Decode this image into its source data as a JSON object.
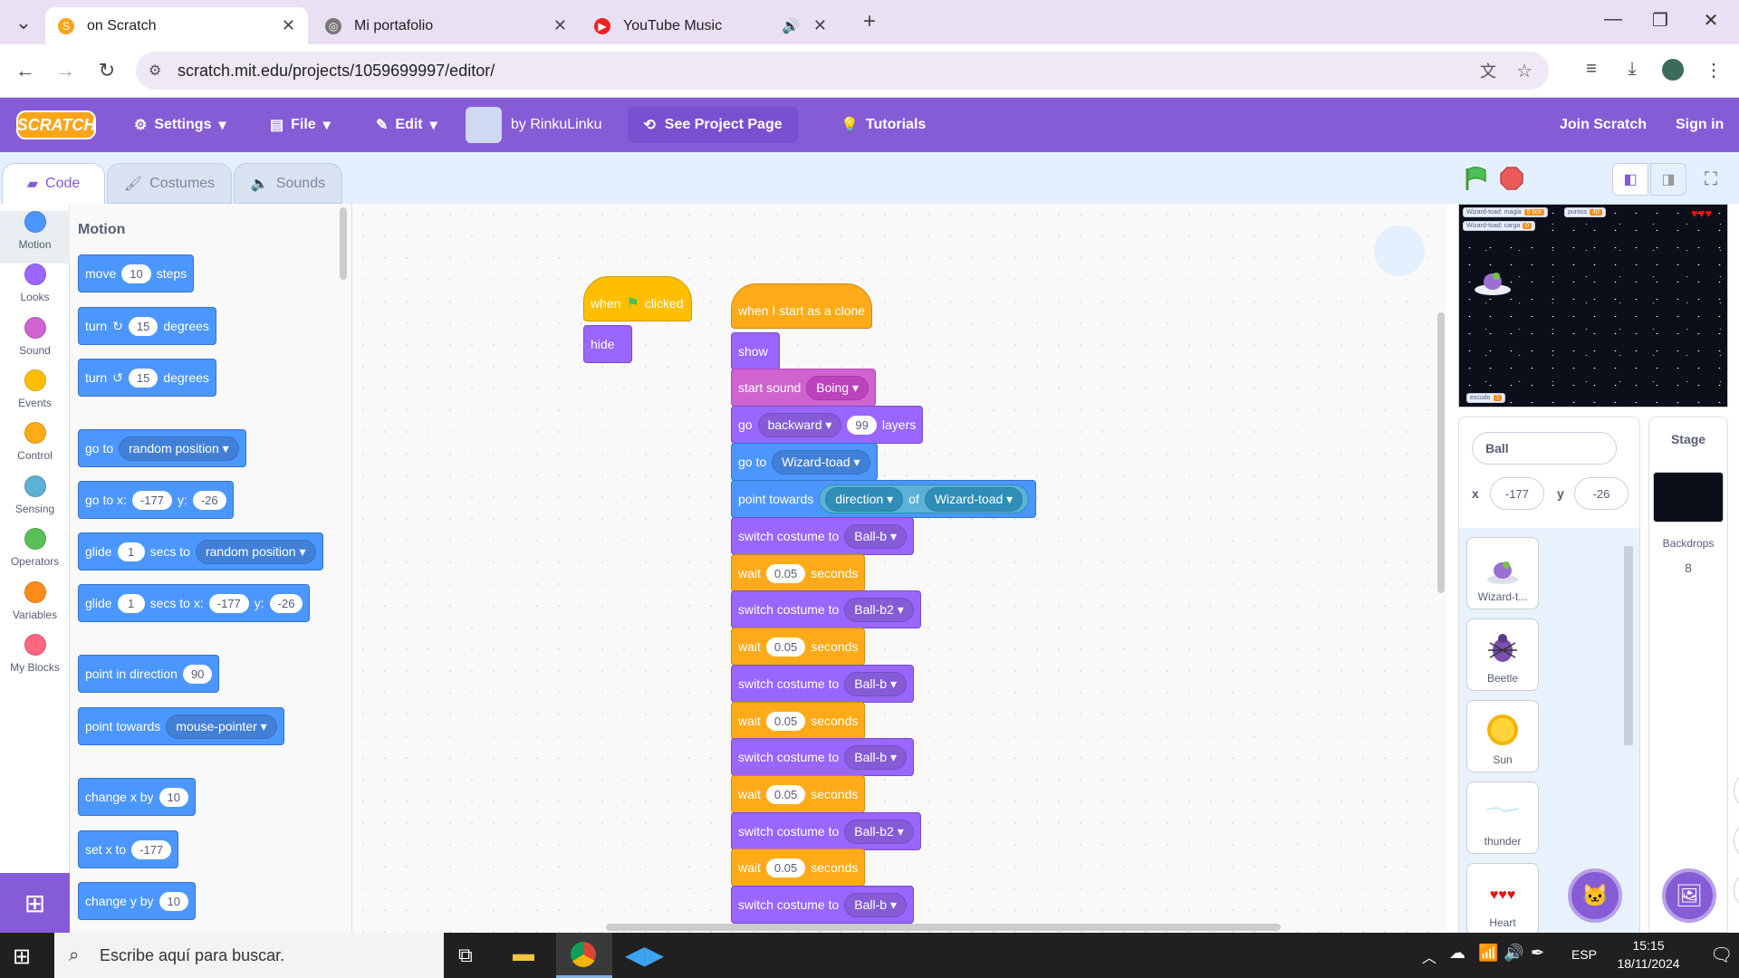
{
  "browser": {
    "tabs": [
      {
        "title": "on Scratch",
        "active": true
      },
      {
        "title": "Mi portafolio",
        "active": false
      },
      {
        "title": "YouTube Music",
        "active": false
      }
    ],
    "url": "scratch.mit.edu/projects/1059699997/editor/"
  },
  "menubar": {
    "logo": "SCRATCH",
    "settings": "Settings",
    "file": "File",
    "edit": "Edit",
    "author": "by RinkuLinku",
    "see_project": "See Project Page",
    "tutorials": "Tutorials",
    "join": "Join Scratch",
    "sign_in": "Sign in"
  },
  "editor_tabs": {
    "code": "Code",
    "costumes": "Costumes",
    "sounds": "Sounds"
  },
  "categories": [
    {
      "label": "Motion",
      "color": "#4c97ff"
    },
    {
      "label": "Looks",
      "color": "#9966ff"
    },
    {
      "label": "Sound",
      "color": "#cf63cf"
    },
    {
      "label": "Events",
      "color": "#ffbf00"
    },
    {
      "label": "Control",
      "color": "#ffab19"
    },
    {
      "label": "Sensing",
      "color": "#5cb1d6"
    },
    {
      "label": "Operators",
      "color": "#59c059"
    },
    {
      "label": "Variables",
      "color": "#ff8c1a"
    },
    {
      "label": "My Blocks",
      "color": "#ff6680"
    }
  ],
  "palette": {
    "title": "Motion",
    "move": {
      "t1": "move",
      "v": "10",
      "t2": "steps"
    },
    "turn_right": {
      "t1": "turn",
      "v": "15",
      "t2": "degrees"
    },
    "turn_left": {
      "t1": "turn",
      "v": "15",
      "t2": "degrees"
    },
    "goto": {
      "t1": "go to",
      "dd": "random position"
    },
    "gotoxy": {
      "t1": "go to x:",
      "x": "-177",
      "t2": "y:",
      "y": "-26"
    },
    "glide_to": {
      "t1": "glide",
      "v": "1",
      "t2": "secs to",
      "dd": "random position"
    },
    "glide_xy": {
      "t1": "glide",
      "v": "1",
      "t2": "secs to x:",
      "x": "-177",
      "t3": "y:",
      "y": "-26"
    },
    "point_dir": {
      "t1": "point in direction",
      "v": "90"
    },
    "point_towards": {
      "t1": "point towards",
      "dd": "mouse-pointer"
    },
    "change_x": {
      "t1": "change x by",
      "v": "10"
    },
    "set_x": {
      "t1": "set x to",
      "v": "-177"
    },
    "change_y": {
      "t1": "change y by",
      "v": "10"
    }
  },
  "scripts": {
    "flag_hat": {
      "t1": "when",
      "t2": "clicked"
    },
    "hide": "hide",
    "clone_hat": "when I start as a clone",
    "show": "show",
    "start_sound": {
      "t1": "start sound",
      "dd": "Boing"
    },
    "go_layers": {
      "t1": "go",
      "dd": "backward",
      "v": "99",
      "t2": "layers"
    },
    "go_to": {
      "t1": "go to",
      "dd": "Wizard-toad"
    },
    "point_towards": {
      "t1": "point towards",
      "dd1": "direction",
      "t2": "of",
      "dd2": "Wizard-toad"
    },
    "sequence": [
      {
        "kind": "costume",
        "t": "switch costume to",
        "v": "Ball-b"
      },
      {
        "kind": "wait",
        "t1": "wait",
        "v": "0.05",
        "t2": "seconds"
      },
      {
        "kind": "costume",
        "t": "switch costume to",
        "v": "Ball-b2"
      },
      {
        "kind": "wait",
        "t1": "wait",
        "v": "0.05",
        "t2": "seconds"
      },
      {
        "kind": "costume",
        "t": "switch costume to",
        "v": "Ball-b"
      },
      {
        "kind": "wait",
        "t1": "wait",
        "v": "0.05",
        "t2": "seconds"
      },
      {
        "kind": "costume",
        "t": "switch costume to",
        "v": "Ball-b"
      },
      {
        "kind": "wait",
        "t1": "wait",
        "v": "0.05",
        "t2": "seconds"
      },
      {
        "kind": "costume",
        "t": "switch costume to",
        "v": "Ball-b2"
      },
      {
        "kind": "wait",
        "t1": "wait",
        "v": "0.05",
        "t2": "seconds"
      },
      {
        "kind": "costume",
        "t": "switch costume to",
        "v": "Ball-b"
      }
    ]
  },
  "stage_monitors": {
    "m1": {
      "label": "Wizard-toad: magia",
      "value": "5 tick"
    },
    "m2": {
      "label": "puntos",
      "value": "40"
    },
    "m3": {
      "label": "Wizard-toad: carga",
      "value": "0"
    },
    "m4": {
      "label": "escudo",
      "value": "1"
    }
  },
  "sprite_info": {
    "name": "Ball",
    "x_label": "x",
    "x": "-177",
    "y_label": "y",
    "y": "-26"
  },
  "sprites": [
    {
      "name": "Wizard-t..."
    },
    {
      "name": "Beetle"
    },
    {
      "name": "Sun"
    },
    {
      "name": "thunder"
    },
    {
      "name": "Heart"
    }
  ],
  "stage_panel": {
    "title": "Stage",
    "backdrops_label": "Backdrops",
    "backdrops_count": "8"
  },
  "taskbar": {
    "search": "Escribe aquí para buscar.",
    "lang": "ESP",
    "time": "15:15",
    "date": "18/11/2024"
  }
}
